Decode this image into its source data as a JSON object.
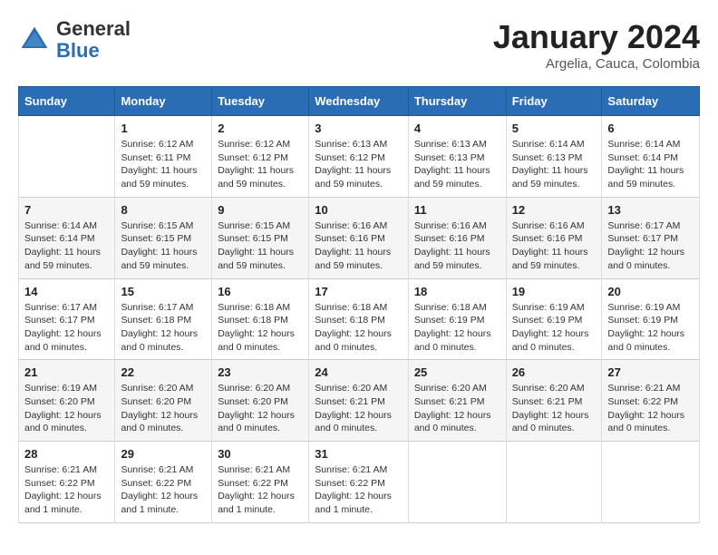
{
  "header": {
    "logo_general": "General",
    "logo_blue": "Blue",
    "month": "January 2024",
    "location": "Argelia, Cauca, Colombia"
  },
  "days_of_week": [
    "Sunday",
    "Monday",
    "Tuesday",
    "Wednesday",
    "Thursday",
    "Friday",
    "Saturday"
  ],
  "weeks": [
    [
      {
        "day": "",
        "sunrise": "",
        "sunset": "",
        "daylight": ""
      },
      {
        "day": "1",
        "sunrise": "Sunrise: 6:12 AM",
        "sunset": "Sunset: 6:11 PM",
        "daylight": "Daylight: 11 hours and 59 minutes."
      },
      {
        "day": "2",
        "sunrise": "Sunrise: 6:12 AM",
        "sunset": "Sunset: 6:12 PM",
        "daylight": "Daylight: 11 hours and 59 minutes."
      },
      {
        "day": "3",
        "sunrise": "Sunrise: 6:13 AM",
        "sunset": "Sunset: 6:12 PM",
        "daylight": "Daylight: 11 hours and 59 minutes."
      },
      {
        "day": "4",
        "sunrise": "Sunrise: 6:13 AM",
        "sunset": "Sunset: 6:13 PM",
        "daylight": "Daylight: 11 hours and 59 minutes."
      },
      {
        "day": "5",
        "sunrise": "Sunrise: 6:14 AM",
        "sunset": "Sunset: 6:13 PM",
        "daylight": "Daylight: 11 hours and 59 minutes."
      },
      {
        "day": "6",
        "sunrise": "Sunrise: 6:14 AM",
        "sunset": "Sunset: 6:14 PM",
        "daylight": "Daylight: 11 hours and 59 minutes."
      }
    ],
    [
      {
        "day": "7",
        "sunrise": "Sunrise: 6:14 AM",
        "sunset": "Sunset: 6:14 PM",
        "daylight": "Daylight: 11 hours and 59 minutes."
      },
      {
        "day": "8",
        "sunrise": "Sunrise: 6:15 AM",
        "sunset": "Sunset: 6:15 PM",
        "daylight": "Daylight: 11 hours and 59 minutes."
      },
      {
        "day": "9",
        "sunrise": "Sunrise: 6:15 AM",
        "sunset": "Sunset: 6:15 PM",
        "daylight": "Daylight: 11 hours and 59 minutes."
      },
      {
        "day": "10",
        "sunrise": "Sunrise: 6:16 AM",
        "sunset": "Sunset: 6:16 PM",
        "daylight": "Daylight: 11 hours and 59 minutes."
      },
      {
        "day": "11",
        "sunrise": "Sunrise: 6:16 AM",
        "sunset": "Sunset: 6:16 PM",
        "daylight": "Daylight: 11 hours and 59 minutes."
      },
      {
        "day": "12",
        "sunrise": "Sunrise: 6:16 AM",
        "sunset": "Sunset: 6:16 PM",
        "daylight": "Daylight: 11 hours and 59 minutes."
      },
      {
        "day": "13",
        "sunrise": "Sunrise: 6:17 AM",
        "sunset": "Sunset: 6:17 PM",
        "daylight": "Daylight: 12 hours and 0 minutes."
      }
    ],
    [
      {
        "day": "14",
        "sunrise": "Sunrise: 6:17 AM",
        "sunset": "Sunset: 6:17 PM",
        "daylight": "Daylight: 12 hours and 0 minutes."
      },
      {
        "day": "15",
        "sunrise": "Sunrise: 6:17 AM",
        "sunset": "Sunset: 6:18 PM",
        "daylight": "Daylight: 12 hours and 0 minutes."
      },
      {
        "day": "16",
        "sunrise": "Sunrise: 6:18 AM",
        "sunset": "Sunset: 6:18 PM",
        "daylight": "Daylight: 12 hours and 0 minutes."
      },
      {
        "day": "17",
        "sunrise": "Sunrise: 6:18 AM",
        "sunset": "Sunset: 6:18 PM",
        "daylight": "Daylight: 12 hours and 0 minutes."
      },
      {
        "day": "18",
        "sunrise": "Sunrise: 6:18 AM",
        "sunset": "Sunset: 6:19 PM",
        "daylight": "Daylight: 12 hours and 0 minutes."
      },
      {
        "day": "19",
        "sunrise": "Sunrise: 6:19 AM",
        "sunset": "Sunset: 6:19 PM",
        "daylight": "Daylight: 12 hours and 0 minutes."
      },
      {
        "day": "20",
        "sunrise": "Sunrise: 6:19 AM",
        "sunset": "Sunset: 6:19 PM",
        "daylight": "Daylight: 12 hours and 0 minutes."
      }
    ],
    [
      {
        "day": "21",
        "sunrise": "Sunrise: 6:19 AM",
        "sunset": "Sunset: 6:20 PM",
        "daylight": "Daylight: 12 hours and 0 minutes."
      },
      {
        "day": "22",
        "sunrise": "Sunrise: 6:20 AM",
        "sunset": "Sunset: 6:20 PM",
        "daylight": "Daylight: 12 hours and 0 minutes."
      },
      {
        "day": "23",
        "sunrise": "Sunrise: 6:20 AM",
        "sunset": "Sunset: 6:20 PM",
        "daylight": "Daylight: 12 hours and 0 minutes."
      },
      {
        "day": "24",
        "sunrise": "Sunrise: 6:20 AM",
        "sunset": "Sunset: 6:21 PM",
        "daylight": "Daylight: 12 hours and 0 minutes."
      },
      {
        "day": "25",
        "sunrise": "Sunrise: 6:20 AM",
        "sunset": "Sunset: 6:21 PM",
        "daylight": "Daylight: 12 hours and 0 minutes."
      },
      {
        "day": "26",
        "sunrise": "Sunrise: 6:20 AM",
        "sunset": "Sunset: 6:21 PM",
        "daylight": "Daylight: 12 hours and 0 minutes."
      },
      {
        "day": "27",
        "sunrise": "Sunrise: 6:21 AM",
        "sunset": "Sunset: 6:22 PM",
        "daylight": "Daylight: 12 hours and 0 minutes."
      }
    ],
    [
      {
        "day": "28",
        "sunrise": "Sunrise: 6:21 AM",
        "sunset": "Sunset: 6:22 PM",
        "daylight": "Daylight: 12 hours and 1 minute."
      },
      {
        "day": "29",
        "sunrise": "Sunrise: 6:21 AM",
        "sunset": "Sunset: 6:22 PM",
        "daylight": "Daylight: 12 hours and 1 minute."
      },
      {
        "day": "30",
        "sunrise": "Sunrise: 6:21 AM",
        "sunset": "Sunset: 6:22 PM",
        "daylight": "Daylight: 12 hours and 1 minute."
      },
      {
        "day": "31",
        "sunrise": "Sunrise: 6:21 AM",
        "sunset": "Sunset: 6:22 PM",
        "daylight": "Daylight: 12 hours and 1 minute."
      },
      {
        "day": "",
        "sunrise": "",
        "sunset": "",
        "daylight": ""
      },
      {
        "day": "",
        "sunrise": "",
        "sunset": "",
        "daylight": ""
      },
      {
        "day": "",
        "sunrise": "",
        "sunset": "",
        "daylight": ""
      }
    ]
  ]
}
